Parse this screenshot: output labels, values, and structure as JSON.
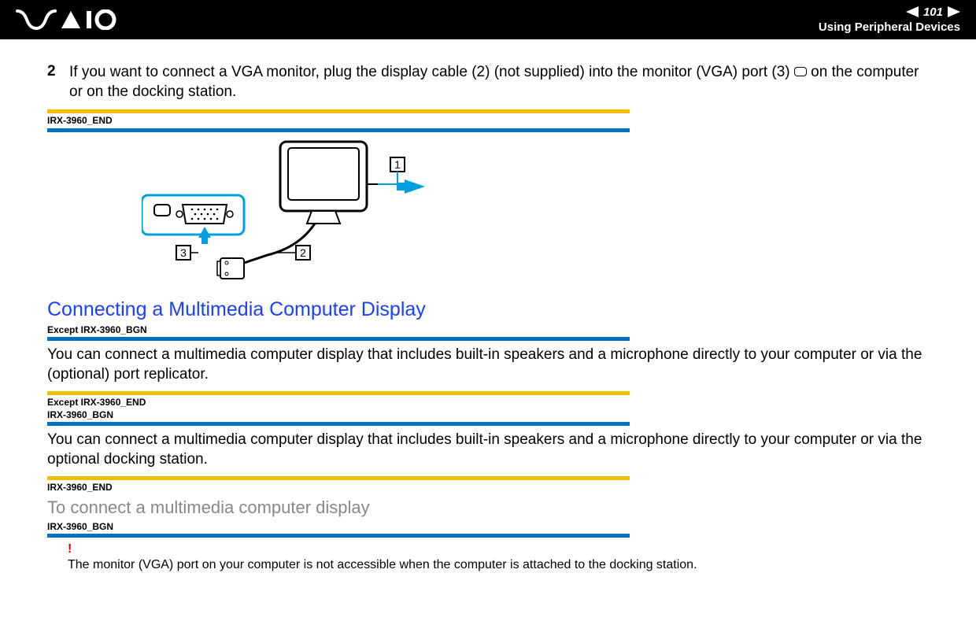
{
  "header": {
    "page_number": "101",
    "section_title": "Using Peripheral Devices"
  },
  "step2": {
    "number": "2",
    "text_before_icon": "If you want to connect a VGA monitor, plug the display cable (2) (not supplied) into the monitor (VGA) port (3) ",
    "text_after_icon": " on the computer or on the docking station."
  },
  "tags": {
    "irx_end": "IRX-3960_END",
    "except_bgn": "Except IRX-3960_BGN",
    "except_end": "Except IRX-3960_END",
    "irx_bgn": "IRX-3960_BGN"
  },
  "diagram": {
    "callout_1": "1",
    "callout_2": "2",
    "callout_3": "3"
  },
  "section": {
    "title": "Connecting a Multimedia Computer Display",
    "para1": "You can connect a multimedia computer display that includes built-in speakers and a microphone directly to your computer or via the (optional) port replicator.",
    "para2": "You can connect a multimedia computer display that includes built-in speakers and a microphone directly to your computer or via the optional docking station.",
    "sub_title": "To connect a multimedia computer display"
  },
  "note": {
    "mark": "!",
    "text": "The monitor (VGA) port on your computer is not accessible when the computer is attached to the docking station."
  }
}
